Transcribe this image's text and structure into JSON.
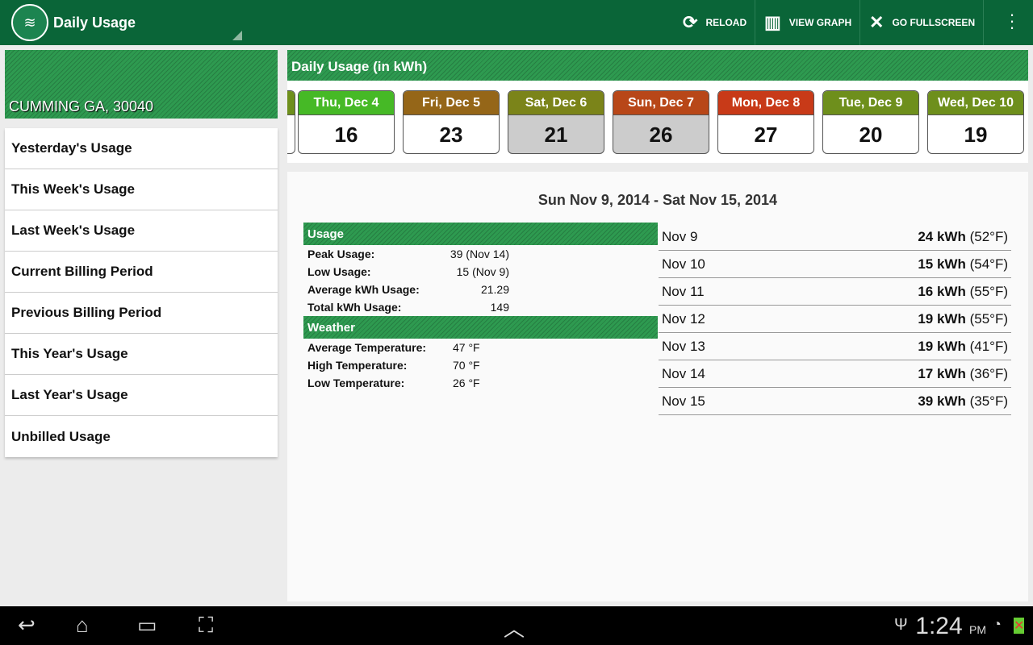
{
  "app": {
    "title": "Daily Usage"
  },
  "actions": [
    {
      "icon": "reload-icon",
      "label": "RELOAD"
    },
    {
      "icon": "bar-chart-icon",
      "label": "VIEW GRAPH"
    },
    {
      "icon": "fullscreen-icon",
      "label": "GO FULLSCREEN"
    }
  ],
  "location": "CUMMING GA, 30040",
  "sidebar": {
    "items": [
      {
        "label": "Yesterday's Usage"
      },
      {
        "label": "This Week's Usage"
      },
      {
        "label": "Last Week's Usage"
      },
      {
        "label": "Current Billing Period"
      },
      {
        "label": "Previous Billing Period"
      },
      {
        "label": "This Year's Usage"
      },
      {
        "label": "Last Year's Usage"
      },
      {
        "label": "Unbilled Usage"
      }
    ]
  },
  "daily": {
    "title": "Daily Usage (in kWh)",
    "days": [
      {
        "label": "Thu, Dec 4",
        "value": "16",
        "color": "#46b926",
        "bg": "#ffffff"
      },
      {
        "label": "Fri, Dec 5",
        "value": "23",
        "color": "#956618",
        "bg": "#ffffff"
      },
      {
        "label": "Sat, Dec 6",
        "value": "21",
        "color": "#7b8419",
        "bg": "#cccccc"
      },
      {
        "label": "Sun, Dec 7",
        "value": "26",
        "color": "#b84718",
        "bg": "#cccccc"
      },
      {
        "label": "Mon, Dec 8",
        "value": "27",
        "color": "#c83a18",
        "bg": "#ffffff"
      },
      {
        "label": "Tue, Dec 9",
        "value": "20",
        "color": "#6e8f1c",
        "bg": "#ffffff"
      },
      {
        "label": "Wed, Dec 10",
        "value": "19",
        "color": "#6e8f1c",
        "bg": "#ffffff"
      }
    ]
  },
  "summary": {
    "range": "Sun Nov 9, 2014 - Sat Nov 15, 2014",
    "usage_title": "Usage",
    "usage": [
      {
        "label": "Peak Usage:",
        "value": "39 (Nov 14)"
      },
      {
        "label": "Low Usage:",
        "value": "15 (Nov 9)"
      },
      {
        "label": "Average kWh Usage:",
        "value": "21.29"
      },
      {
        "label": "Total kWh Usage:",
        "value": "149"
      }
    ],
    "weather_title": "Weather",
    "weather": [
      {
        "label": "Average Temperature:",
        "value": "47 °F"
      },
      {
        "label": "High Temperature:",
        "value": "70 °F"
      },
      {
        "label": "Low Temperature:",
        "value": "26 °F"
      }
    ],
    "days": [
      {
        "date": "Nov 9",
        "value": "24 kWh",
        "temp": "(52°F)"
      },
      {
        "date": "Nov 10",
        "value": "15 kWh",
        "temp": "(54°F)"
      },
      {
        "date": "Nov 11",
        "value": "16 kWh",
        "temp": "(55°F)"
      },
      {
        "date": "Nov 12",
        "value": "19 kWh",
        "temp": "(55°F)"
      },
      {
        "date": "Nov 13",
        "value": "19 kWh",
        "temp": "(41°F)"
      },
      {
        "date": "Nov 14",
        "value": "17 kWh",
        "temp": "(36°F)"
      },
      {
        "date": "Nov 15",
        "value": "39 kWh",
        "temp": "(35°F)"
      }
    ]
  },
  "status": {
    "time": "1:24",
    "ampm": "PM"
  }
}
